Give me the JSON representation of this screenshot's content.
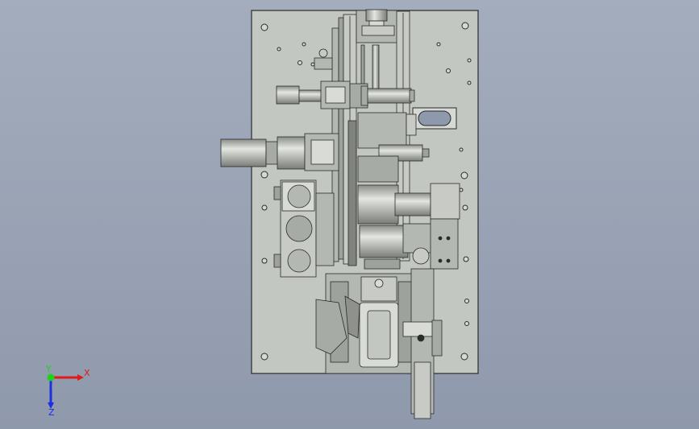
{
  "viewport": {
    "background_top": "#a4adbd",
    "background_bottom": "#8f99ac",
    "plate_fill": "#c3c7c1",
    "line_color": "#2a2c2a",
    "metal_fill": "#b4b8b2",
    "dark_metal": "#8e918c"
  },
  "triad": {
    "x_label": "X",
    "y_label": "Y",
    "z_label": "Z",
    "x_color": "#e01b1b",
    "y_color": "#1bd41b",
    "z_color": "#1b2fe0"
  }
}
